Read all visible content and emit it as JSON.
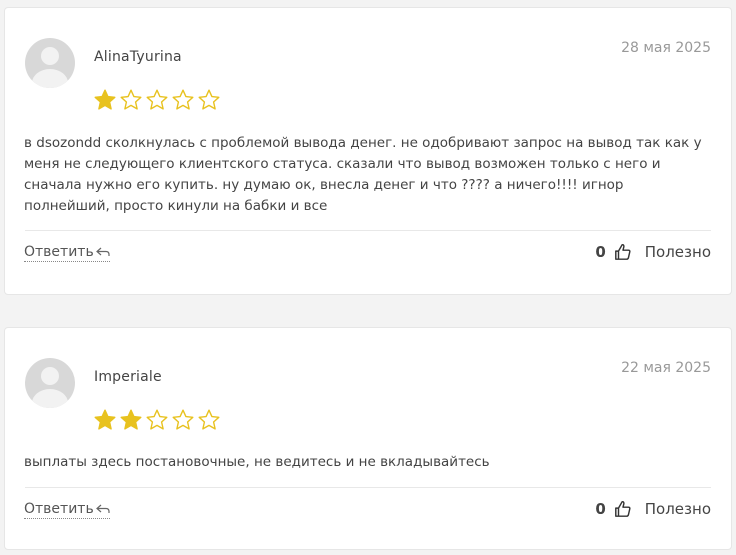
{
  "colors": {
    "star_filled": "#e8c21f",
    "star_empty_stroke": "#e8c21f"
  },
  "reviews": [
    {
      "author": "AlinaTyurina",
      "date": "28 мая 2025",
      "rating": 1,
      "max_rating": 5,
      "text": "в dsozondd сколкнулась с проблемой вывода денег. не одобривают запрос на вывод так как у меня не следующего клиентского статуса. сказали что вывод возможен только с него и сначала нужно его купить. ну думаю ок, внесла денег и что ???? а ничего!!!! игнор полнейший, просто кинули на бабки и все",
      "reply_label": "Ответить",
      "likes": "0",
      "useful_label": "Полезно"
    },
    {
      "author": "Imperiale",
      "date": "22 мая 2025",
      "rating": 2,
      "max_rating": 5,
      "text": "выплаты здесь постановочные, не ведитесь и не вкладывайтесь",
      "reply_label": "Ответить",
      "likes": "0",
      "useful_label": "Полезно"
    }
  ],
  "icons": {
    "avatar": "user-placeholder-icon",
    "reply": "reply-arrow-icon",
    "like": "thumbs-up-icon",
    "star": "star-icon"
  }
}
